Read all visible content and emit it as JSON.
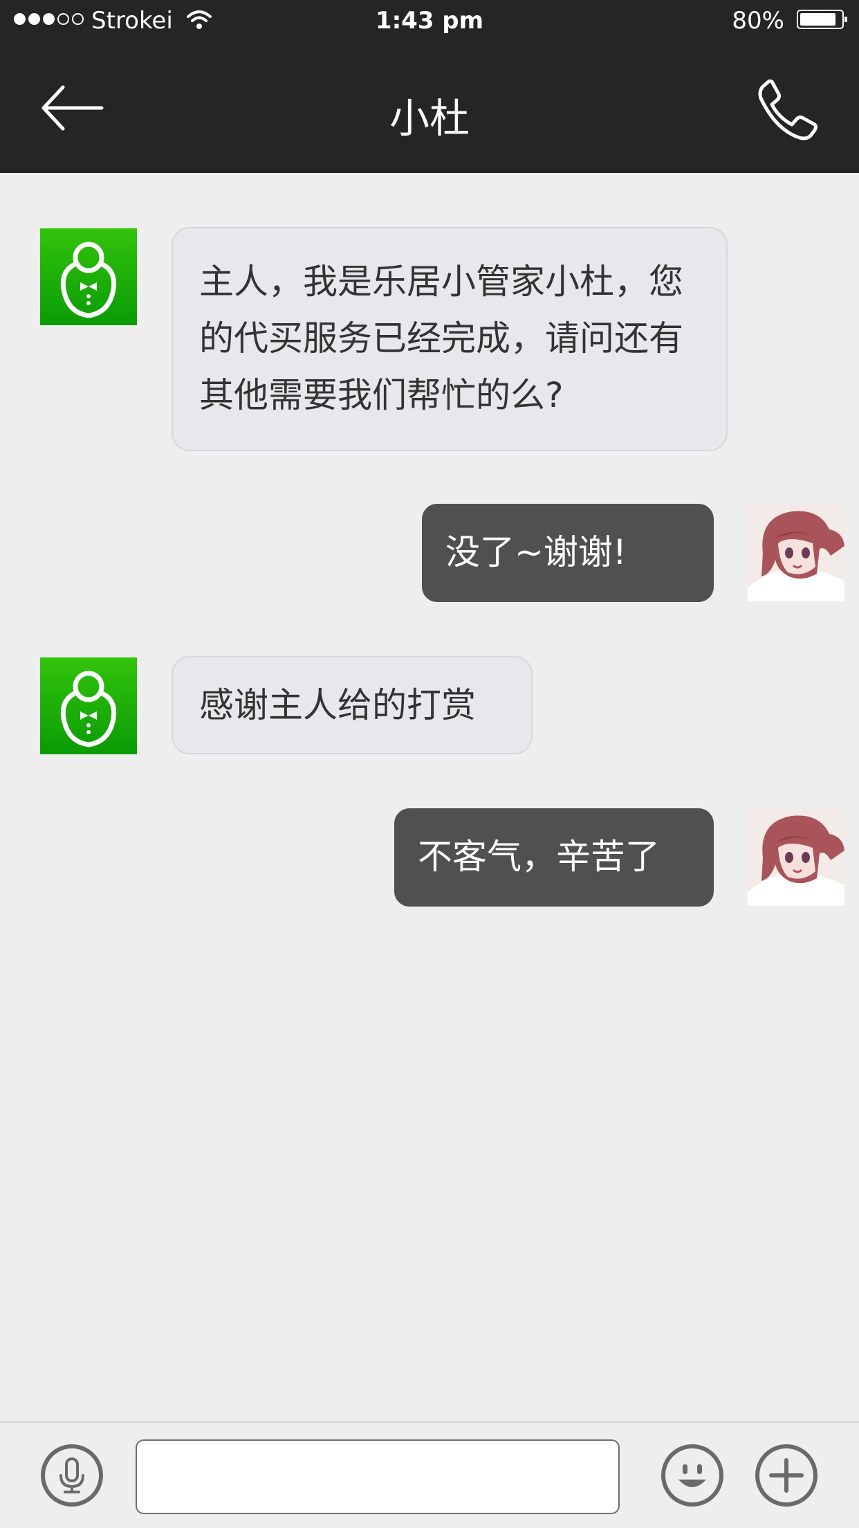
{
  "status_bar": {
    "carrier": "Strokei",
    "time": "1:43 pm",
    "battery_text": "80%",
    "battery_level": 0.8,
    "signal_bars_filled": 3,
    "signal_bars_total": 5,
    "icons": [
      "signal-dots-icon",
      "wifi-icon",
      "battery-icon"
    ]
  },
  "header": {
    "title": "小杜",
    "back_icon": "arrow-left-icon",
    "call_icon": "phone-icon"
  },
  "messages": [
    {
      "side": "in",
      "sender_avatar": "butler-avatar",
      "text": "主人，我是乐居小管家小杜，您的代买服务已经完成，请问还有其他需要我们帮忙的么?"
    },
    {
      "side": "out",
      "sender_avatar": "user-avatar",
      "text": "没了~谢谢!"
    },
    {
      "side": "in",
      "sender_avatar": "butler-avatar",
      "text": "感谢主人给的打赏"
    },
    {
      "side": "out",
      "sender_avatar": "user-avatar",
      "text": "不客气，辛苦了"
    }
  ],
  "input_bar": {
    "input_value": "",
    "icons": [
      "microphone-icon",
      "emoji-icon",
      "plus-icon"
    ]
  },
  "colors": {
    "header_bg": "#252525",
    "chat_bg": "#eeeeee",
    "incoming_bubble": "#e7e7ec",
    "outgoing_bubble": "#505050",
    "butler_green": "#1ab608"
  }
}
